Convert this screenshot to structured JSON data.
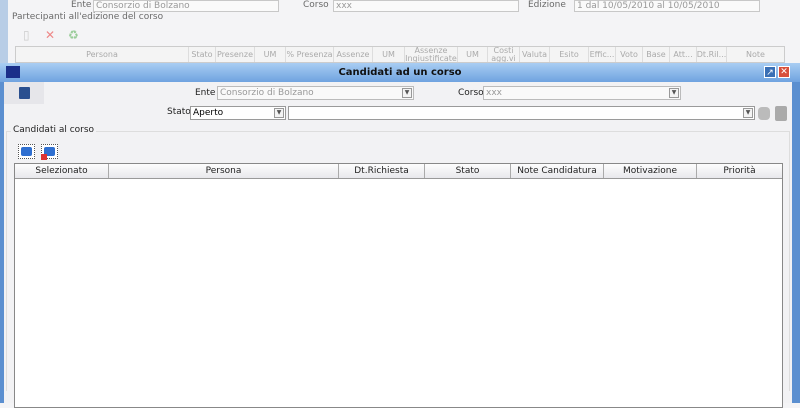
{
  "background": {
    "ente_label": "Ente",
    "ente_value": "Consorzio di Bolzano",
    "corso_label": "Corso",
    "corso_value": "xxx",
    "edizione_label": "Edizione",
    "edizione_value": "1 dal 10/05/2010 al 10/05/2010",
    "group_label": "Partecipanti all'edizione del corso",
    "columns": [
      "Persona",
      "Stato",
      "Presenze",
      "UM",
      "% Presenza",
      "Assenze",
      "UM",
      "Assenze Ingiustificate",
      "UM",
      "Costi agg.vi",
      "Valuta",
      "Esito",
      "Effic...",
      "Voto",
      "Base",
      "Att...",
      "Dt.Ril...",
      "Note"
    ]
  },
  "dialog": {
    "title": "Candidati ad un corso",
    "ente_label": "Ente",
    "ente_value": "Consorzio di Bolzano",
    "corso_label": "Corso",
    "corso_value": "xxx",
    "stato_label": "Stato",
    "stato_value": "Aperto",
    "filter_value": "",
    "group_label": "Candidati al corso",
    "columns": [
      "Selezionato",
      "Persona",
      "Dt.Richiesta",
      "Stato",
      "Note Candidatura",
      "Motivazione",
      "Priorità"
    ]
  }
}
